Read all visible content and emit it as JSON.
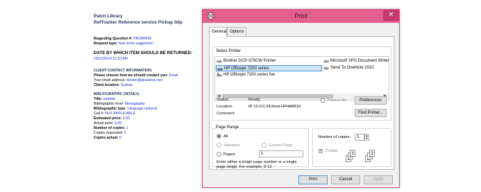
{
  "slip": {
    "library": "Patch Library",
    "subtitle": "RefTracker Reference service Pickup Slip",
    "question_prefix": "Regarding Question #:",
    "question_id": "PROB#696",
    "request_type_label": "Request type:",
    "request_type": "New book suggestion",
    "return_heading": "DATE BY WHICH ITEM SHOULD BE RETURNED:",
    "return_date": "19/12/2014 11:10 AM",
    "contact_heading": "CLIENT CONTACT INFORMATION:",
    "contact_method_label": "Please choose how we should contact you:",
    "contact_method": "Email",
    "email_label": "Your email address:",
    "email": "dsnder@altarama.com",
    "location_label": "Client location:",
    "location": "Sydney",
    "biblio_heading": "BIBLIOGRAPHIC DETAILS:",
    "title_label": "Title:",
    "title_value": "sadada",
    "level_label": "Bibliographic level:",
    "level_value": "Monographs",
    "type_label": "Bibliographic type:",
    "type_value": "Language material",
    "call_label": "Call #:",
    "call_value": "NOT APPLICABLE",
    "est_price_label": "Estimated price:",
    "est_price": "0.00",
    "actual_price_label": "Actual price:",
    "actual_price": "0.00",
    "num_copies_label": "Number of copies:",
    "num_copies": "1",
    "copies_requested_label": "Copies requested:",
    "copies_requested": "0",
    "copies_actual_label": "Copies actual:",
    "copies_actual": "0"
  },
  "dialog": {
    "title": "Print",
    "close_glyph": "✕",
    "accent_color": "#e35f8e",
    "tabs": [
      "General",
      "Options"
    ],
    "select_printer_label": "Select Printer",
    "printers": [
      {
        "name": "Brother DCP-375CW Printer",
        "icon": "printer-icon"
      },
      {
        "name": "HP Officejet 7200 series",
        "icon": "printer-icon",
        "selected": true
      },
      {
        "name": "HP Officejet 7200 series fax",
        "icon": "fax-icon"
      },
      {
        "name": "Microsoft XPS Document Writer",
        "icon": "printer-icon"
      },
      {
        "name": "Send To OneNote 2010",
        "icon": "printer-icon"
      }
    ],
    "status_label": "Status:",
    "status_value": "Ready",
    "location_label": "Location:",
    "location_value": "IP-10.0.0.24;Host-HP4A8810",
    "comment_label": "Comment:",
    "print_to_file": "Print to file",
    "preferences": "Preferences",
    "find_printer": "Find Printer...",
    "page_range_label": "Page Range",
    "range_all": "All",
    "range_selection": "Selection",
    "range_current": "Current Page",
    "range_pages": "Pages:",
    "pages_value": "1",
    "range_hint_1": "Enter either a single page number or a single",
    "range_hint_2": "page range.  For example, 5-12",
    "copies_label": "Number of copies:",
    "copies_value": "1",
    "collate": "Collate",
    "collate_pages": [
      "1",
      "2",
      "3"
    ],
    "print_btn": "Print",
    "cancel_btn": "Cancel",
    "apply_btn": "Apply"
  }
}
